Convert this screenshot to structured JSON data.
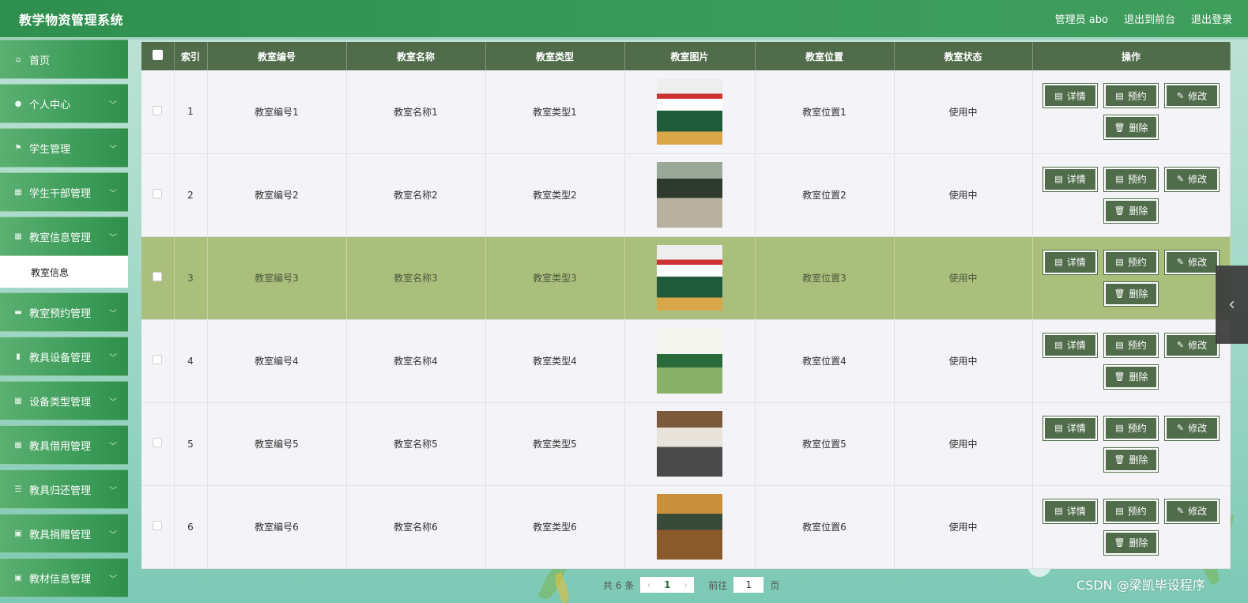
{
  "header": {
    "title": "教学物资管理系统",
    "admin": "管理员 abo",
    "front": "退出到前台",
    "logout": "退出登录"
  },
  "sidebar": {
    "items": [
      {
        "label": "首页",
        "icon": "home-icon",
        "arrow": false
      },
      {
        "label": "个人中心",
        "icon": "user-icon",
        "arrow": true
      },
      {
        "label": "学生管理",
        "icon": "flag-icon",
        "arrow": true
      },
      {
        "label": "学生干部管理",
        "icon": "grid-icon",
        "arrow": true
      },
      {
        "label": "教室信息管理",
        "icon": "grid-icon",
        "arrow": true
      },
      {
        "label": "教室预约管理",
        "icon": "chat-icon",
        "arrow": true
      },
      {
        "label": "教具设备管理",
        "icon": "chart-icon",
        "arrow": true
      },
      {
        "label": "设备类型管理",
        "icon": "grid-icon",
        "arrow": true
      },
      {
        "label": "教具借用管理",
        "icon": "grid-icon",
        "arrow": true
      },
      {
        "label": "教具归还管理",
        "icon": "list-icon",
        "arrow": true
      },
      {
        "label": "教具捐赠管理",
        "icon": "clipboard-icon",
        "arrow": true
      },
      {
        "label": "教材信息管理",
        "icon": "clipboard-icon",
        "arrow": true
      }
    ],
    "submenu": "教室信息"
  },
  "table": {
    "headers": [
      "索引",
      "教室编号",
      "教室名称",
      "教室类型",
      "教室图片",
      "教室位置",
      "教室状态",
      "操作"
    ],
    "rows": [
      {
        "idx": "1",
        "code": "教室编号1",
        "name": "教室名称1",
        "type": "教室类型1",
        "loc": "教室位置1",
        "status": "使用中"
      },
      {
        "idx": "2",
        "code": "教室编号2",
        "name": "教室名称2",
        "type": "教室类型2",
        "loc": "教室位置2",
        "status": "使用中"
      },
      {
        "idx": "3",
        "code": "教室编号3",
        "name": "教室名称3",
        "type": "教室类型3",
        "loc": "教室位置3",
        "status": "使用中"
      },
      {
        "idx": "4",
        "code": "教室编号4",
        "name": "教室名称4",
        "type": "教室类型4",
        "loc": "教室位置4",
        "status": "使用中"
      },
      {
        "idx": "5",
        "code": "教室编号5",
        "name": "教室名称5",
        "type": "教室类型5",
        "loc": "教室位置5",
        "status": "使用中"
      },
      {
        "idx": "6",
        "code": "教室编号6",
        "name": "教室名称6",
        "type": "教室类型6",
        "loc": "教室位置6",
        "status": "使用中"
      }
    ],
    "actions": {
      "detail": "详情",
      "reserve": "预约",
      "edit": "修改",
      "delete": "删除"
    }
  },
  "pagination": {
    "total": "共 6 条",
    "current": "1",
    "goto_label": "前往",
    "goto_value": "1",
    "page_suffix": "页"
  },
  "watermark": "CSDN @梁凯毕设程序",
  "colors": {
    "header": "#3a9a5a",
    "table_header": "#506c4a",
    "highlight_row": "#abbf7d"
  }
}
